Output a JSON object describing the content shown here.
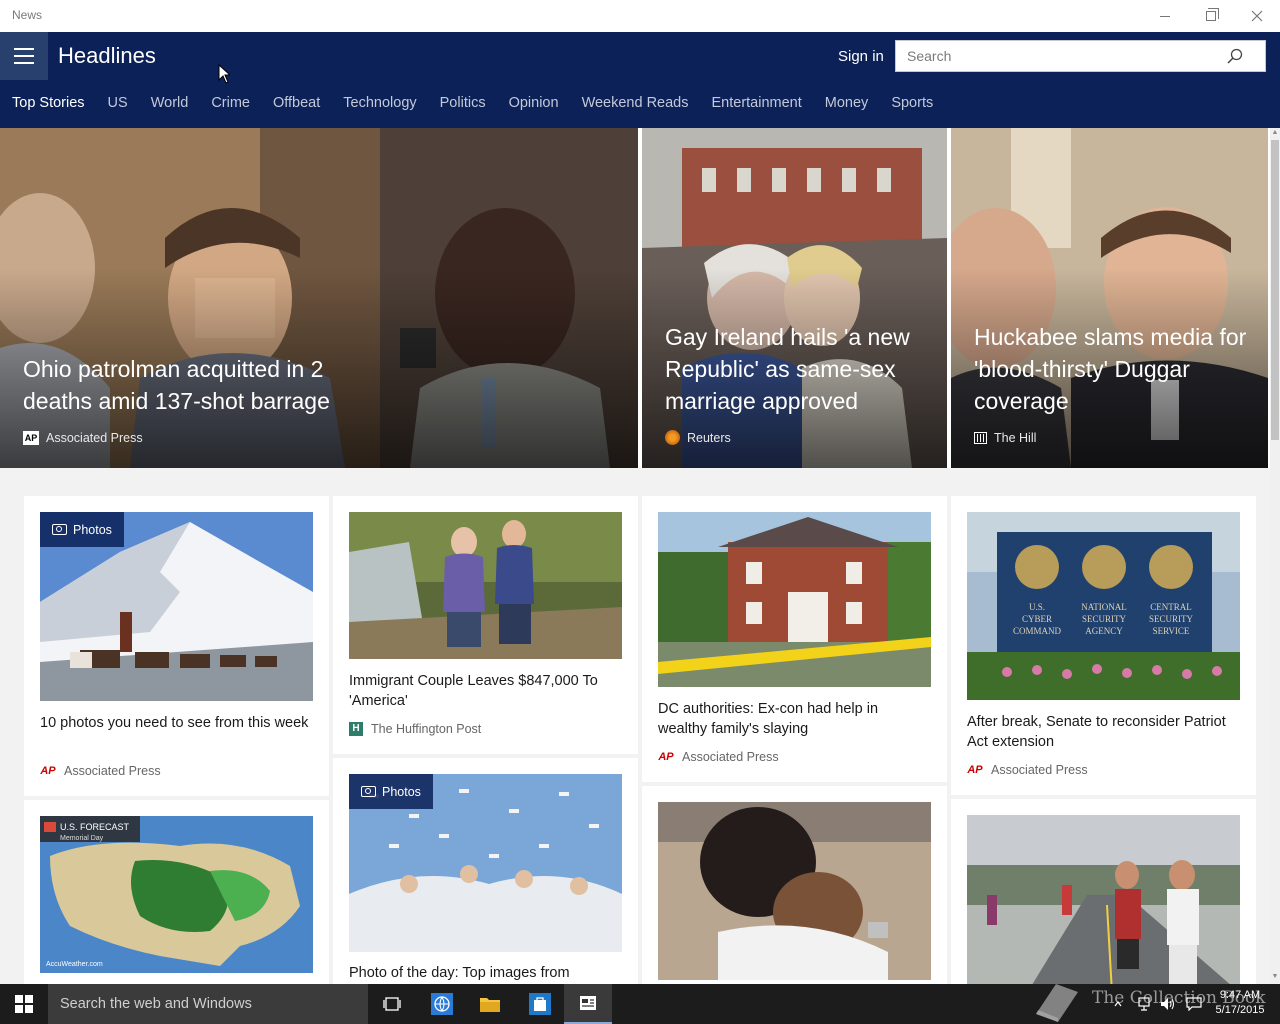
{
  "window": {
    "title": "News"
  },
  "header": {
    "title": "Headlines",
    "sign_in": "Sign in",
    "search_placeholder": "Search",
    "tabs": [
      "Top Stories",
      "US",
      "World",
      "Crime",
      "Offbeat",
      "Technology",
      "Politics",
      "Opinion",
      "Weekend Reads",
      "Entertainment",
      "Money",
      "Sports"
    ],
    "active_tab": "Top Stories"
  },
  "hero": [
    {
      "title": "Ohio patrolman acquitted in 2 deaths amid 137-shot barrage",
      "source": "Associated Press",
      "logo": "ap-logo"
    },
    {
      "title": "Gay Ireland hails 'a new Republic' as same-sex marriage approved",
      "source": "Reuters",
      "logo": "reuters-logo"
    },
    {
      "title": "Huckabee slams media for 'blood-thirsty' Duggar coverage",
      "source": "The Hill",
      "logo": "the-hill-logo"
    }
  ],
  "cards": {
    "c1": {
      "badge": "Photos",
      "title": "10 photos you need to see from this week",
      "source": "Associated Press",
      "logo": "AP"
    },
    "c2": {
      "title": "Immigrant Couple Leaves $847,000 To 'America'",
      "source": "The Huffington Post",
      "logo": "H"
    },
    "c3": {
      "title": "DC authorities: Ex-con had help in wealthy family's slaying",
      "source": "Associated Press",
      "logo": "AP"
    },
    "c4": {
      "title": "After break, Senate to reconsider Patriot Act extension",
      "source": "Associated Press",
      "logo": "AP"
    },
    "c5": {
      "map_title": "U.S. FORECAST",
      "map_sub": "Memorial Day",
      "map_credit": "AccuWeather.com"
    },
    "c6": {
      "badge": "Photos",
      "title": "Photo of the day: Top images from"
    },
    "c4_sign": [
      "U.S.",
      "CYBER",
      "COMMAND",
      "NATIONAL",
      "SECURITY",
      "AGENCY",
      "CENTRAL",
      "SECURITY",
      "SERVICE"
    ]
  },
  "taskbar": {
    "search_placeholder": "Search the web and Windows",
    "time": "9:47 AM",
    "date": "5/17/2015",
    "watermark": "The Collection Book"
  },
  "colors": {
    "header_bg": "#0b2157",
    "accent": "#27406e"
  }
}
